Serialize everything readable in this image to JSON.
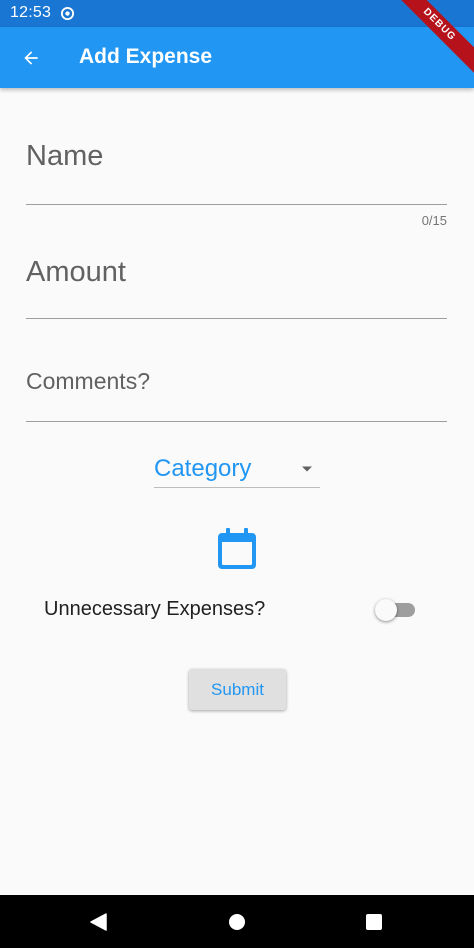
{
  "status_bar": {
    "time": "12:53",
    "icons": [
      "sync-icon",
      "wifi-icon"
    ]
  },
  "debug_banner": "DEBUG",
  "app_bar": {
    "back_icon": "arrow-back-icon",
    "title": "Add Expense"
  },
  "form": {
    "name": {
      "label": "Name",
      "value": "",
      "counter": "0/15"
    },
    "amount": {
      "label": "Amount",
      "value": ""
    },
    "comments": {
      "label": "Comments?",
      "value": ""
    },
    "category": {
      "label": "Category",
      "icon": "dropdown-arrow-icon"
    },
    "date_picker_icon": "calendar-icon",
    "unnecessary_expense": {
      "label": "Unnecessary Expenses?",
      "checked": false
    },
    "submit_label": "Submit"
  },
  "nav_bar": {
    "icons": [
      "back-triangle-icon",
      "home-circle-icon",
      "recents-square-icon"
    ]
  },
  "colors": {
    "primary": "#2196f3",
    "status_bar": "#1976d2",
    "background": "#fafafa",
    "debug_banner": "#b5121b"
  }
}
